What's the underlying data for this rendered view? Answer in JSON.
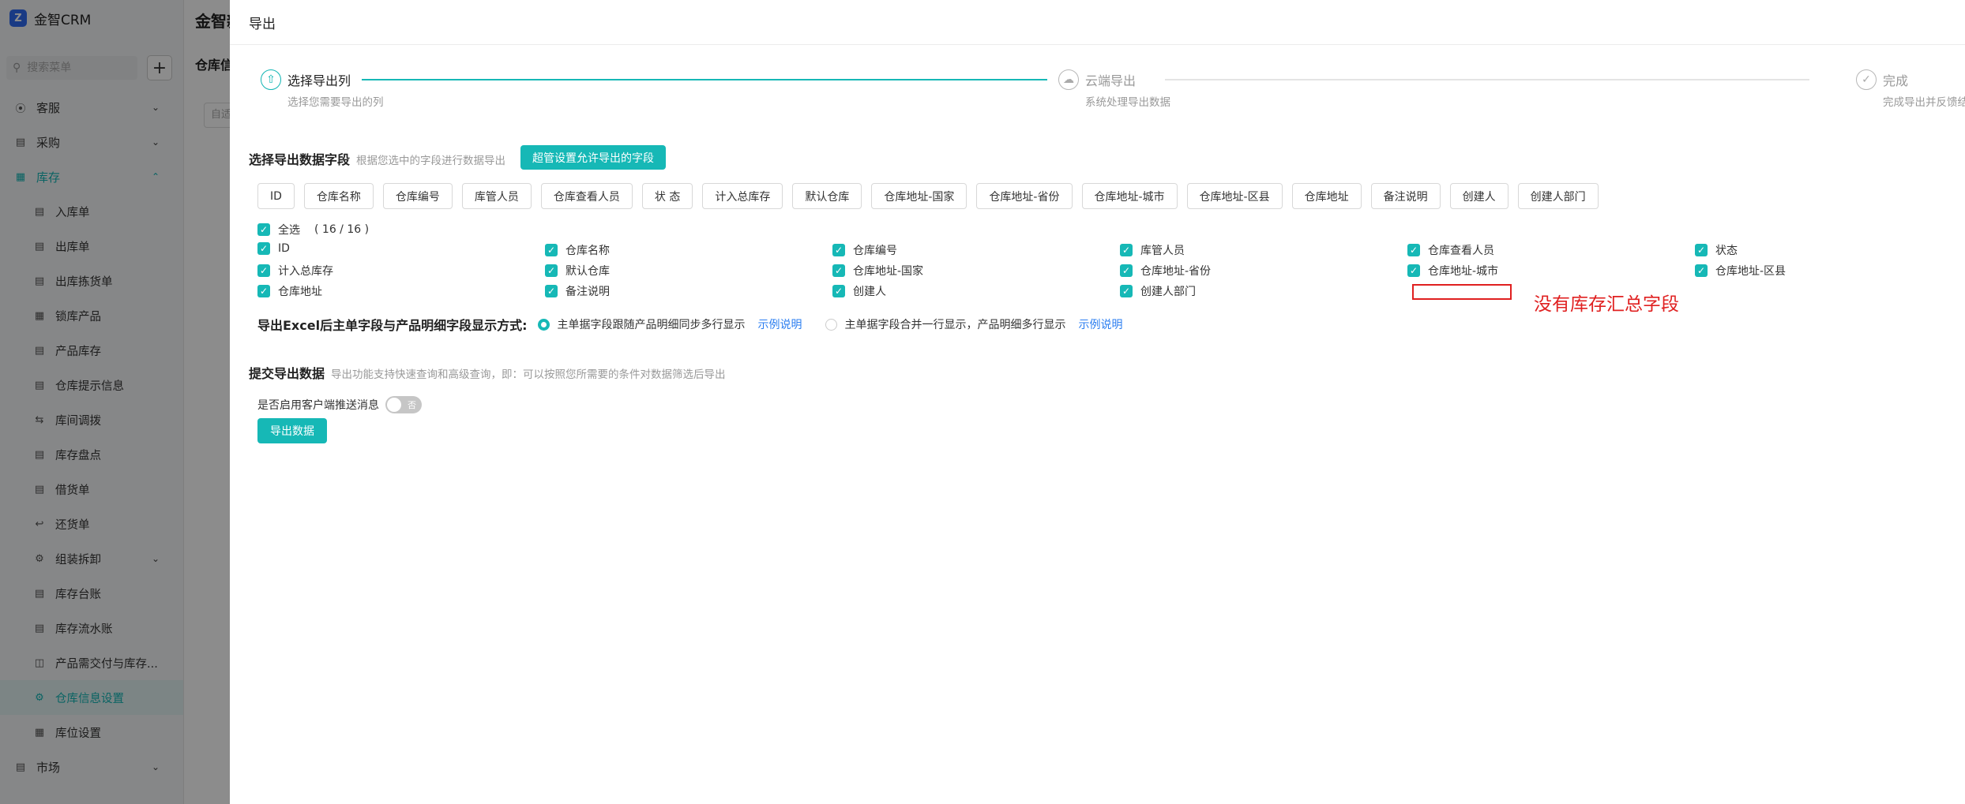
{
  "sidebar": {
    "brand": "金智CRM",
    "search_placeholder": "搜索菜单",
    "add_icon": "+",
    "menu": [
      {
        "label": "客服",
        "icon": "compass-icon",
        "chevron": "down"
      },
      {
        "label": "采购",
        "icon": "cart-icon",
        "chevron": "down"
      },
      {
        "label": "库存",
        "icon": "store-icon",
        "chevron": "up",
        "open": true
      }
    ],
    "sub_menu": [
      "入库单",
      "出库单",
      "出库拣货单",
      "锁库产品",
      "产品库存",
      "仓库提示信息",
      "库间调拨",
      "库存盘点",
      "借货单",
      "还货单",
      "组装拆卸",
      "库存台账",
      "库存流水账",
      "产品需交付与库存...",
      "仓库信息设置",
      "库位设置"
    ],
    "active_sub": "仓库信息设置",
    "bottom_item": "市场"
  },
  "background": {
    "header_title": "金智新",
    "crumb": "仓库信",
    "input_placeholder": "自适"
  },
  "drawer": {
    "title": "导出",
    "steps": [
      {
        "title": "选择导出列",
        "desc": "选择您需要导出的列",
        "active": true
      },
      {
        "title": "云端导出",
        "desc": "系统处理导出数据",
        "active": false
      },
      {
        "title": "完成",
        "desc": "完成导出并反馈结",
        "active": false
      }
    ],
    "select_section": {
      "title": "选择导出数据字段",
      "desc": "根据您选中的字段进行数据导出",
      "admin_button": "超管设置允许导出的字段"
    },
    "tags": [
      "ID",
      "仓库名称",
      "仓库编号",
      "库管人员",
      "仓库查看人员",
      "状 态",
      "计入总库存",
      "默认仓库",
      "仓库地址-国家",
      "仓库地址-省份",
      "仓库地址-城市",
      "仓库地址-区县",
      "仓库地址",
      "备注说明",
      "创建人",
      "创建人部门"
    ],
    "select_all": {
      "label": "全选",
      "count": "( 16 / 16 )"
    },
    "fields": [
      "ID",
      "仓库名称",
      "仓库编号",
      "库管人员",
      "仓库查看人员",
      "状态",
      "计入总库存",
      "默认仓库",
      "仓库地址-国家",
      "仓库地址-省份",
      "仓库地址-城市",
      "仓库地址-区县",
      "仓库地址",
      "备注说明",
      "创建人",
      "创建人部门"
    ],
    "annotation": "没有库存汇总字段",
    "excel_mode": {
      "label": "导出Excel后主单字段与产品明细字段显示方式:",
      "option1": "主单据字段跟随产品明细同步多行显示",
      "option2": "主单据字段合并一行显示，产品明细多行显示",
      "link": "示例说明",
      "selected": 1
    },
    "submit_section": {
      "title": "提交导出数据",
      "desc": "导出功能支持快速查询和高级查询，即：可以按照您所需要的条件对数据筛选后导出",
      "push_label": "是否启用客户端推送消息",
      "toggle_label": "否",
      "export_button": "导出数据"
    },
    "colors": {
      "accent": "#16b8b6",
      "link": "#2a7df0",
      "annotation": "#e02020"
    }
  }
}
